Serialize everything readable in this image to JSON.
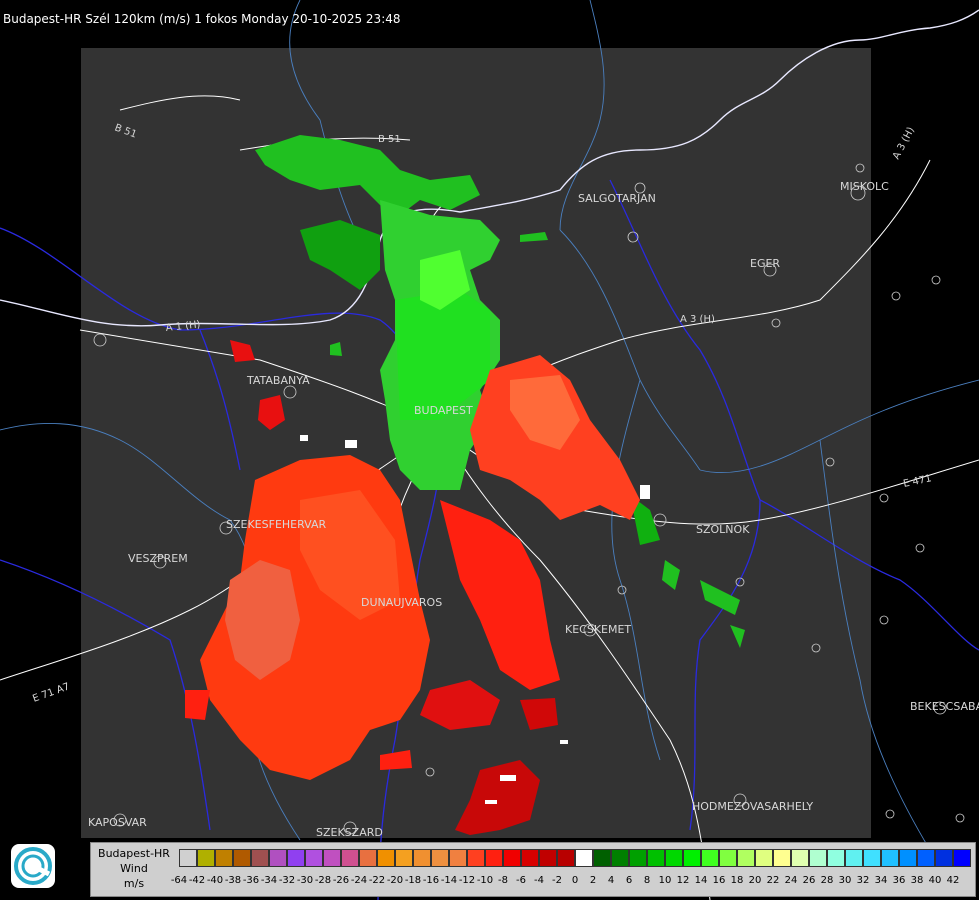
{
  "header": {
    "title": "Budapest-HR Szél 120km (m/s) 1 fokos Monday 20-10-2025 23:48"
  },
  "places": {
    "salgotarjan": "SALGOTARJAN",
    "miskolc": "MISKOLC",
    "eger": "EGER",
    "tatabanya": "TATABANYA",
    "budapest": "BUDAPEST",
    "szekesfehervar": "SZEKESFEHERVAR",
    "veszprem": "VESZPREM",
    "dunaujvaros": "DUNAUJVAROS",
    "kecskemet": "KECSKEMET",
    "szolnok": "SZOLNOK",
    "bekescsaba": "BEKESCSABA",
    "hodmezovasarhely": "HODMEZOVASARHELY",
    "kaposvar": "KAPOSVAR",
    "szekszard": "SZEKSZARD"
  },
  "roads": {
    "b51_west": "B 51",
    "b51_north": "B 51",
    "a3_east": "A 3 (H)",
    "a3_mid": "A 3 (H)",
    "a1": "A 1 (H)",
    "e71": "E 71 A7",
    "e471": "E 471"
  },
  "legend": {
    "line1": "Budapest-HR",
    "line2": "Wind",
    "line3": "m/s",
    "labels": [
      "-64",
      "-42",
      "-40",
      "-38",
      "-36",
      "-34",
      "-32",
      "-30",
      "-28",
      "-26",
      "-24",
      "-22",
      "-20",
      "-18",
      "-16",
      "-14",
      "-12",
      "-10",
      "-8",
      "-6",
      "-4",
      "-2",
      "0",
      "2",
      "4",
      "6",
      "8",
      "10",
      "12",
      "14",
      "16",
      "18",
      "20",
      "22",
      "24",
      "26",
      "28",
      "30",
      "32",
      "34",
      "36",
      "38",
      "40",
      "42"
    ],
    "colors": [
      "#d0d0d0",
      "#b0b000",
      "#c08000",
      "#b05a00",
      "#a05050",
      "#b050c0",
      "#9040f0",
      "#b050e0",
      "#c050c0",
      "#d05090",
      "#e87040",
      "#f09000",
      "#f4a020",
      "#f09030",
      "#ee9040",
      "#f08040",
      "#ff4020",
      "#ff2010",
      "#f00000",
      "#d80000",
      "#c00000",
      "#b80000",
      "#ffffff",
      "#006000",
      "#008000",
      "#00a000",
      "#00c000",
      "#00d800",
      "#00f000",
      "#40ff20",
      "#80ff40",
      "#b0ff60",
      "#e0ff80",
      "#ffff90",
      "#e0ffb0",
      "#b0ffd0",
      "#90ffe0",
      "#60f0f0",
      "#40e0ff",
      "#20c0ff",
      "#0090ff",
      "#0060ff",
      "#0030e0",
      "#0000ff"
    ]
  },
  "icons": {
    "logo": "radar-logo-icon"
  }
}
